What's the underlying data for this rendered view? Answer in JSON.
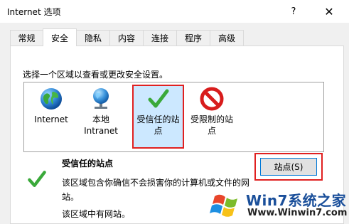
{
  "window": {
    "title": "Internet 选项",
    "help_label": "?",
    "close_label": "✕"
  },
  "tabs": [
    {
      "label": "常规",
      "active": false
    },
    {
      "label": "安全",
      "active": true
    },
    {
      "label": "隐私",
      "active": false
    },
    {
      "label": "内容",
      "active": false
    },
    {
      "label": "连接",
      "active": false
    },
    {
      "label": "程序",
      "active": false
    },
    {
      "label": "高级",
      "active": false
    }
  ],
  "security": {
    "instruction": "选择一个区域以查看或更改安全设置。",
    "zones": [
      {
        "label": "Internet",
        "icon": "globe-icon"
      },
      {
        "label": "本地\nIntranet",
        "icon": "intranet-globe-icon"
      },
      {
        "label": "受信任的站\n点",
        "icon": "green-check-icon",
        "selected": true
      },
      {
        "label": "受限制的站\n点",
        "icon": "no-entry-icon"
      }
    ],
    "selected_zone": {
      "title": "受信任的站点",
      "description": "该区域包含你确信不会损害你的计算机或文件的网站。",
      "note": "该区域中有网站。",
      "sites_button": "站点(S)"
    }
  },
  "watermark": {
    "title": "Win7系统之家",
    "url": "Www.Winwin7.com"
  },
  "colors": {
    "highlight": "#e02020",
    "selection": "#cce8ff",
    "focus": "#0078d7"
  }
}
